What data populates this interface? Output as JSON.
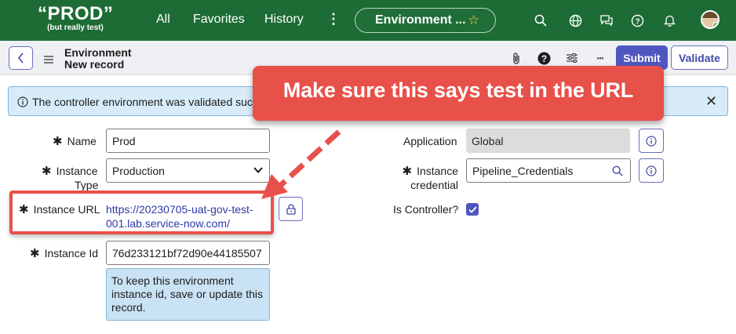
{
  "topnav": {
    "logo_main": "“PROD”",
    "logo_sub": "(but really test)",
    "links": [
      "All",
      "Favorites",
      "History"
    ],
    "more_glyph": "⋮",
    "env_pill": "Environment ...",
    "icons": [
      "search-icon",
      "globe-icon",
      "chat-icon",
      "help-icon",
      "bell-icon"
    ]
  },
  "header": {
    "title_line1": "Environment",
    "title_line2": "New record",
    "more_glyph": "•••",
    "submit": "Submit",
    "validate": "Validate"
  },
  "banner": {
    "text": "The controller environment was validated succ",
    "close": "✕"
  },
  "callout": {
    "text": "Make sure this says test in the URL"
  },
  "form": {
    "name": {
      "label": "Name",
      "value": "Prod"
    },
    "instance_type": {
      "label_line1": "Instance",
      "label_line2": "Type",
      "value": "Production"
    },
    "instance_url": {
      "label": "Instance URL",
      "value_line1": "https://20230705-uat-gov-test-",
      "value_line2": "001.lab.service-now.com/"
    },
    "instance_id": {
      "label": "Instance Id",
      "value": "76d233121bf72d90e44185507",
      "help": "To keep this environment instance id, save or update this record."
    },
    "application": {
      "label": "Application",
      "value": "Global"
    },
    "instance_credential": {
      "label_line1": "Instance",
      "label_line2": "credential",
      "value": "Pipeline_Credentials"
    },
    "is_controller": {
      "label": "Is Controller?",
      "checked": true
    }
  },
  "colors": {
    "nav_green": "#1d6b35",
    "accent": "#5056c0",
    "callout_red": "#e8504a",
    "banner_blue": "#d7ecf8"
  }
}
